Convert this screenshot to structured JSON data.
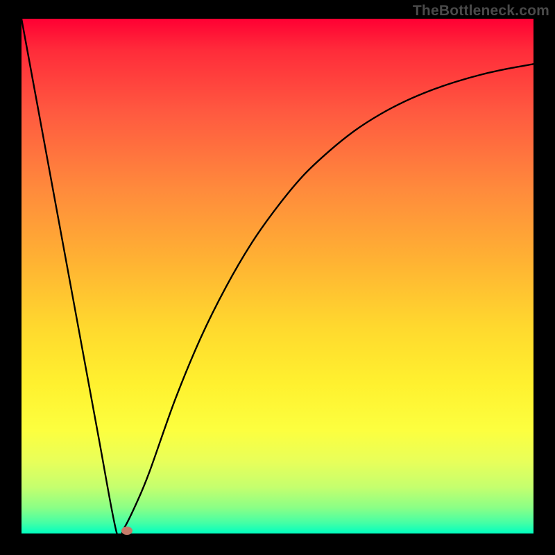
{
  "watermark": "TheBottleneck.com",
  "chart_data": {
    "type": "line",
    "title": "",
    "xlabel": "",
    "ylabel": "",
    "xlim": [
      0,
      100
    ],
    "ylim": [
      0,
      100
    ],
    "grid": false,
    "legend": false,
    "series": [
      {
        "name": "curve",
        "x": [
          0,
          5,
          10,
          15,
          18.6,
          20,
          22.5,
          25,
          30,
          35,
          40,
          45,
          50,
          55,
          60,
          65,
          70,
          75,
          80,
          85,
          90,
          95,
          100
        ],
        "y": [
          100,
          73,
          46,
          19,
          0.1,
          1,
          6,
          12,
          26,
          38,
          48,
          56.5,
          63.5,
          69.5,
          74.2,
          78.2,
          81.4,
          84,
          86.1,
          87.8,
          89.2,
          90.3,
          91.2
        ],
        "color": "#000000"
      }
    ],
    "marker": {
      "x": 20.6,
      "y": 0.6,
      "color": "#c77b6a"
    },
    "gradient_stops": [
      {
        "pos": 0,
        "color": "#ff0033"
      },
      {
        "pos": 50,
        "color": "#ffc531"
      },
      {
        "pos": 80,
        "color": "#fcff3f"
      },
      {
        "pos": 100,
        "color": "#00ffc0"
      }
    ]
  }
}
